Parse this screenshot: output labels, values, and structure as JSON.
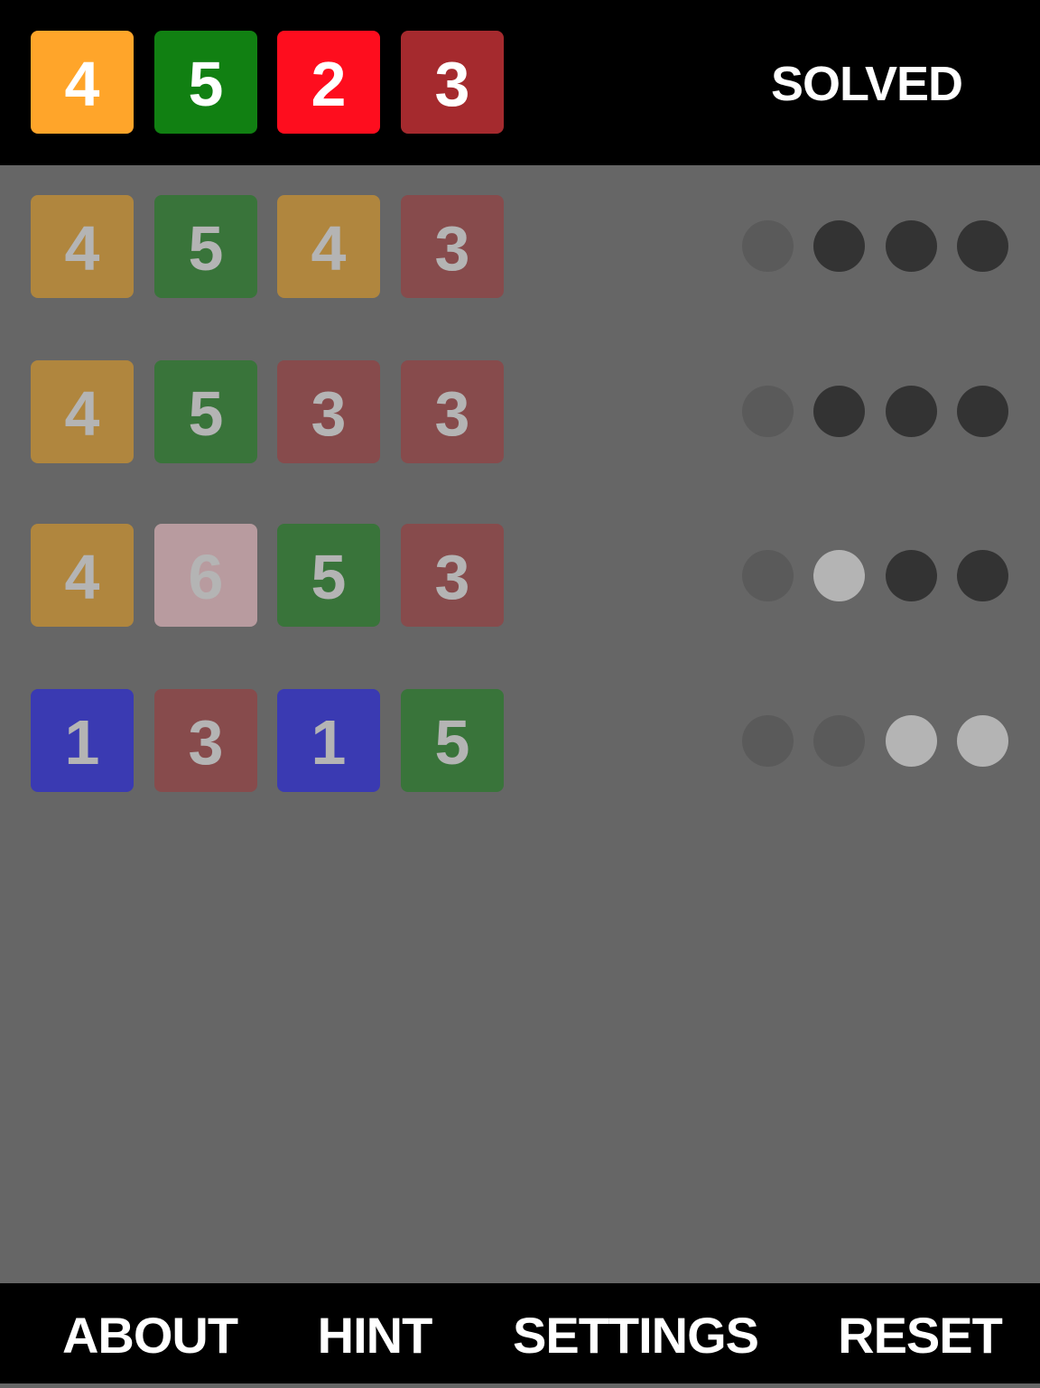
{
  "solution": {
    "digits": [
      "4",
      "5",
      "2",
      "3"
    ],
    "colors": [
      "#ffa52a",
      "#118012",
      "#fe0d1e",
      "#a52a2e"
    ]
  },
  "status": "SOLVED",
  "guesses": [
    {
      "digits": [
        "4",
        "5",
        "4",
        "3"
      ],
      "colors": [
        "#b0863e",
        "#39743a",
        "#b0863e",
        "#874b4c"
      ],
      "pegs": [
        "none",
        "black",
        "black",
        "black"
      ]
    },
    {
      "digits": [
        "4",
        "5",
        "3",
        "3"
      ],
      "colors": [
        "#b0863e",
        "#39743a",
        "#874b4c",
        "#874b4c"
      ],
      "pegs": [
        "none",
        "black",
        "black",
        "black"
      ]
    },
    {
      "digits": [
        "4",
        "6",
        "5",
        "3"
      ],
      "colors": [
        "#b0863e",
        "#b89b9f",
        "#39743a",
        "#874b4c"
      ],
      "pegs": [
        "none",
        "white",
        "black",
        "black"
      ]
    },
    {
      "digits": [
        "1",
        "3",
        "1",
        "5"
      ],
      "colors": [
        "#3a3ab2",
        "#874b4c",
        "#3a3ab2",
        "#39743a"
      ],
      "pegs": [
        "none",
        "none",
        "white",
        "white"
      ]
    }
  ],
  "peg_colors": {
    "none": "#5a5a5a",
    "black": "#333333",
    "white": "#b4b4b4"
  },
  "footer": {
    "about": "ABOUT",
    "hint": "HINT",
    "settings": "SETTINGS",
    "reset": "RESET"
  }
}
